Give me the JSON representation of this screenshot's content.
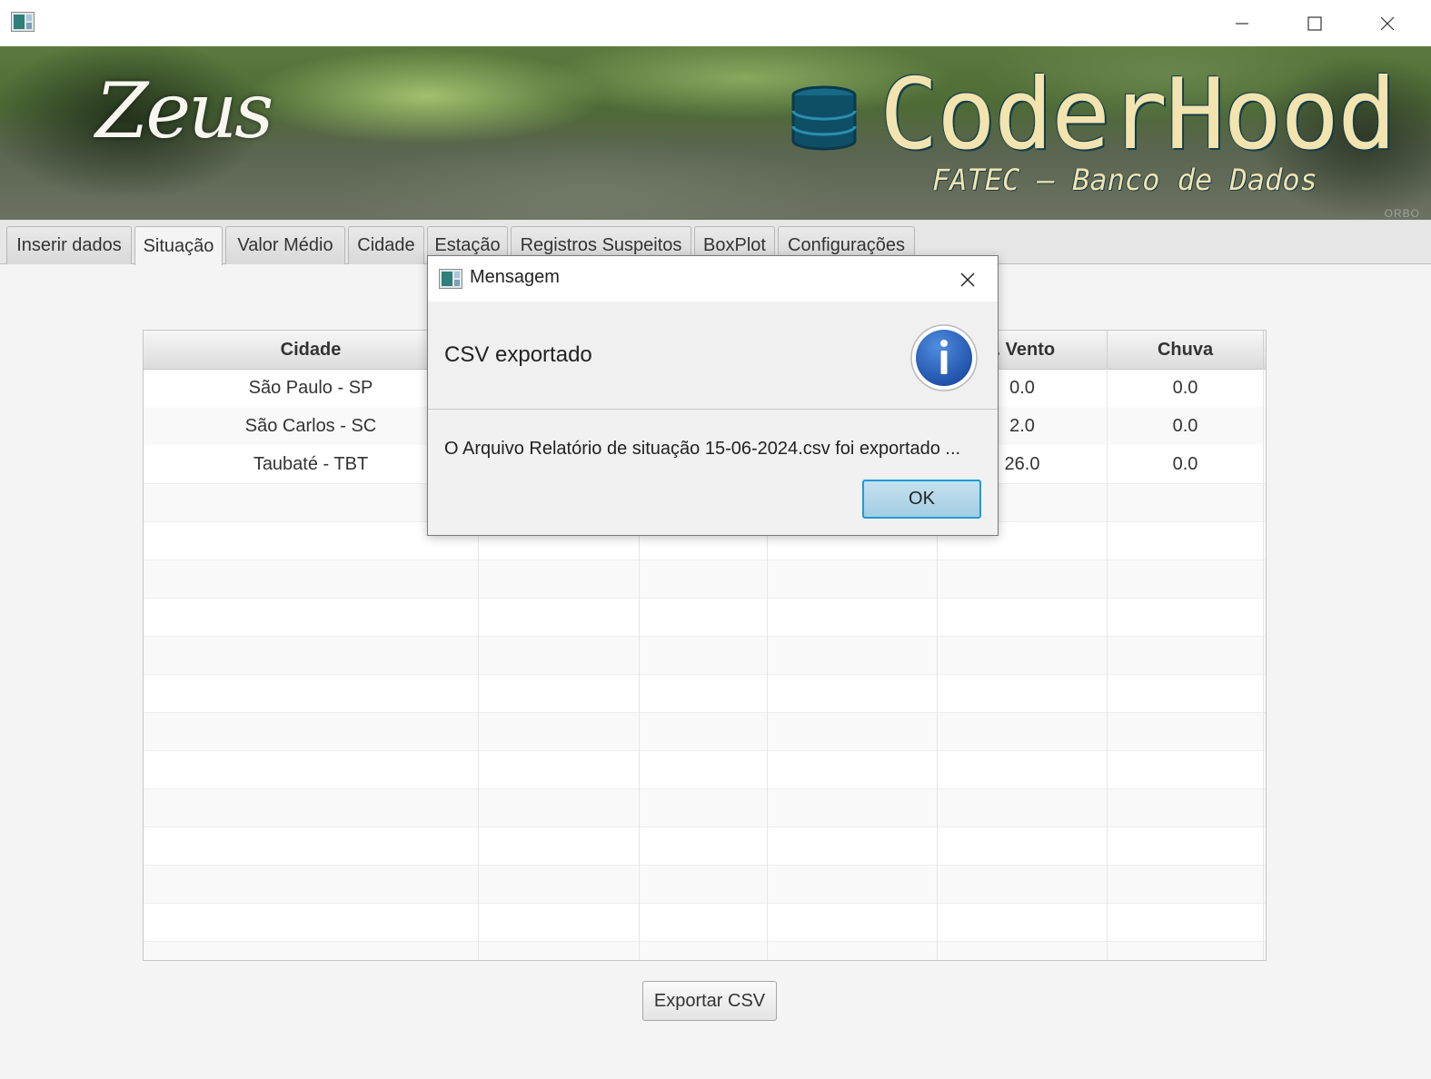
{
  "window": {
    "icons": [
      "app-icon",
      "minimize-icon",
      "maximize-icon",
      "close-icon"
    ]
  },
  "banner": {
    "left_title": "Zeus",
    "brand": "CoderHood",
    "subtitle": "FATEC – Banco de Dados",
    "corner_mark": "ORBO",
    "icon": "database-icon"
  },
  "tabs": [
    {
      "label": "Inserir dados"
    },
    {
      "label": "Situação",
      "active": true
    },
    {
      "label": "Valor Médio"
    },
    {
      "label": "Cidade"
    },
    {
      "label": "Estação"
    },
    {
      "label": "Registros Suspeitos"
    },
    {
      "label": "BoxPlot"
    },
    {
      "label": "Configurações"
    }
  ],
  "table": {
    "columns": [
      "Cidade",
      "",
      "",
      "",
      "r. Vento",
      "Chuva"
    ],
    "rows": [
      [
        "São Paulo - SP",
        "",
        "",
        "",
        "0.0",
        "0.0"
      ],
      [
        "São Carlos - SC",
        "",
        "",
        "",
        "2.0",
        "0.0"
      ],
      [
        "Taubaté - TBT",
        "",
        "",
        "",
        "26.0",
        "0.0"
      ]
    ]
  },
  "export_button": "Exportar CSV",
  "dialog": {
    "title": "Mensagem",
    "header": "CSV exportado",
    "content": "O Arquivo Relatório de situação 15-06-2024.csv foi exportado ...",
    "ok_label": "OK",
    "icon": "info-icon"
  },
  "colors": {
    "brand_text": "#f3e3ae",
    "info_blue": "#2f66c4",
    "ok_border": "#1d9ad6"
  }
}
